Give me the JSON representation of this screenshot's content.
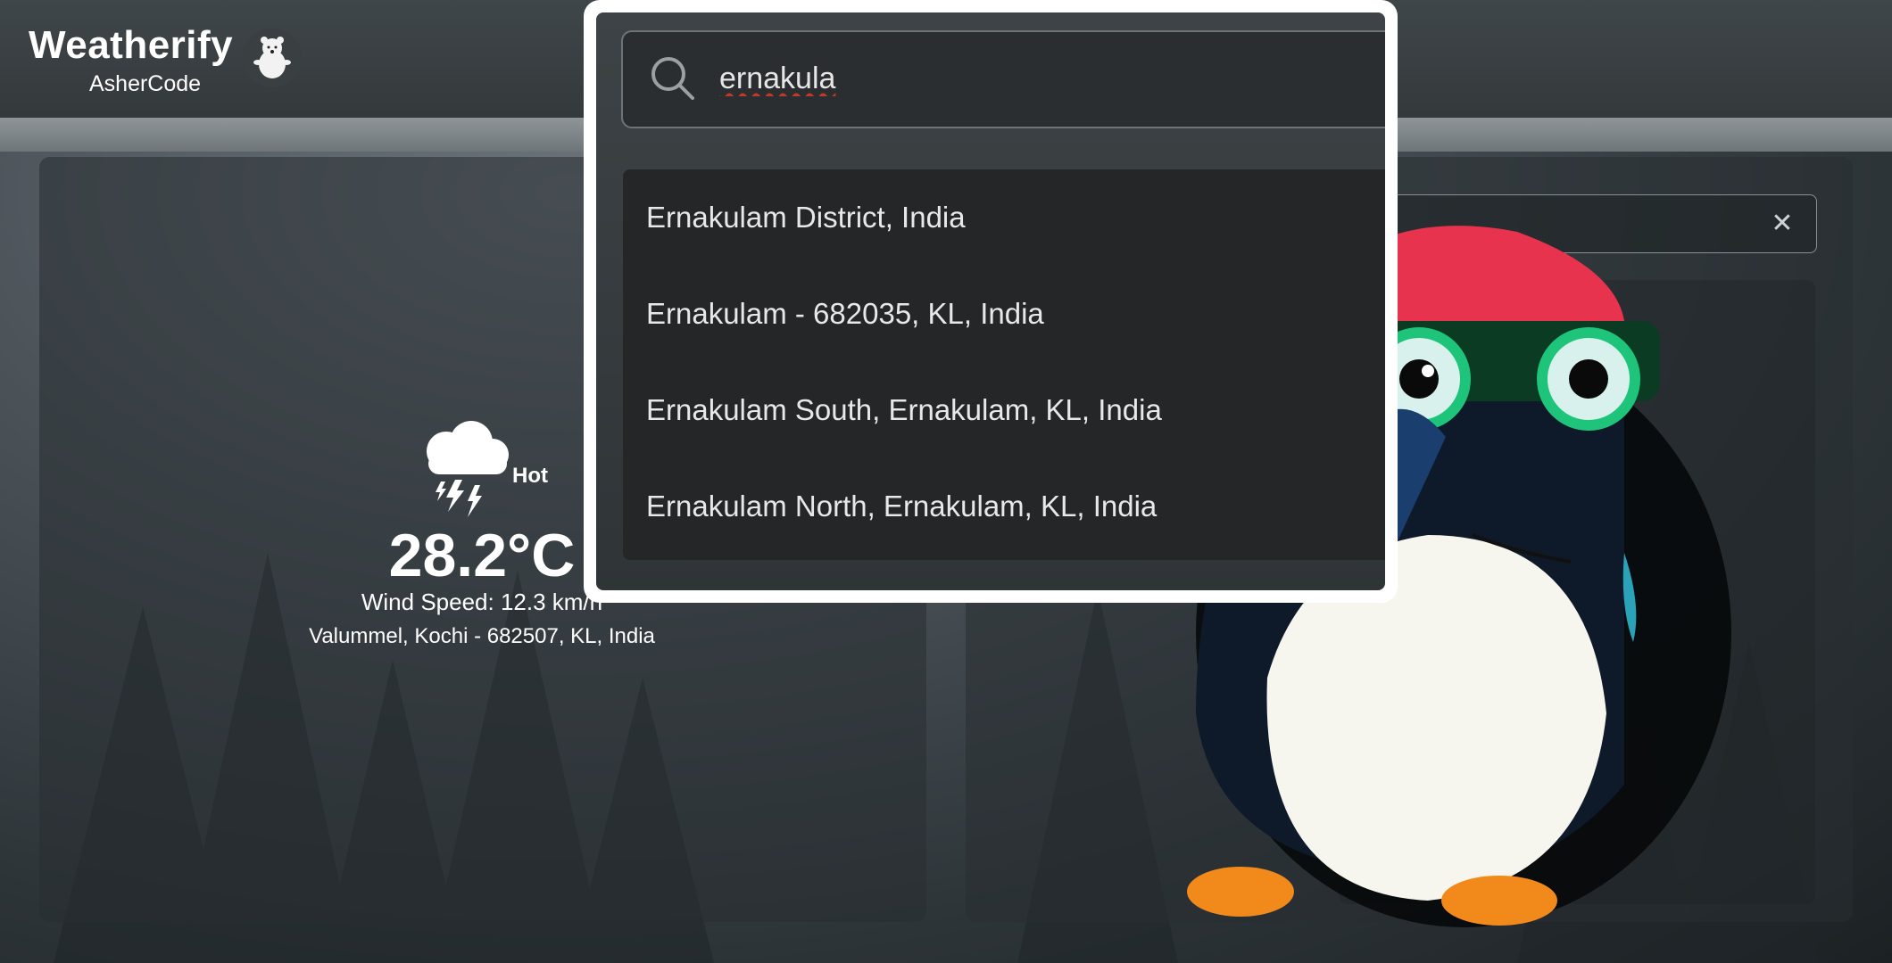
{
  "brand": {
    "title": "Weatherify",
    "subtitle": "AsherCode"
  },
  "weather": {
    "condition": "Hot",
    "temperature": "28.2°C",
    "wind": "Wind Speed: 12.3 km/h",
    "location": "Valummel, Kochi - 682507, KL, India"
  },
  "search": {
    "value": "ernakula",
    "suggestions": [
      "Ernakulam District, India",
      "Ernakulam - 682035, KL, India",
      "Ernakulam South, Ernakulam, KL, India",
      "Ernakulam North, Ernakulam, KL, India"
    ]
  },
  "icons": {
    "search": "search-icon",
    "clear": "close-icon",
    "weather": "thunderstorm-cloud-icon",
    "logo": "polar-bear-icon"
  }
}
